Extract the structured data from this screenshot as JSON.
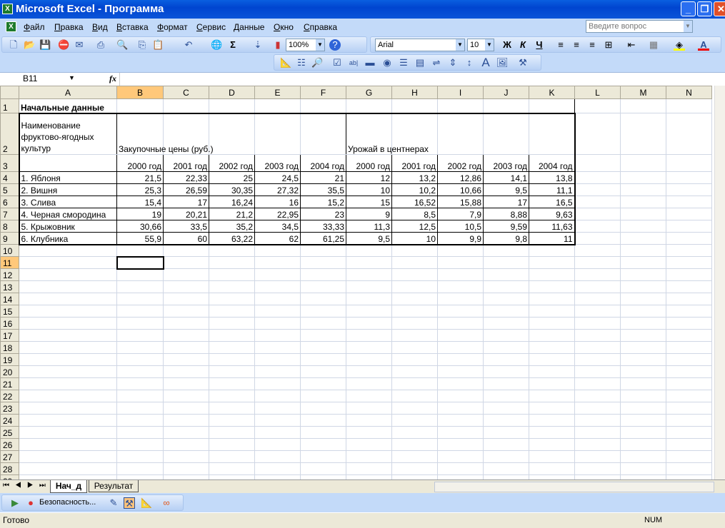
{
  "window": {
    "title": "Microsoft Excel - Программа"
  },
  "menu": [
    "Файл",
    "Правка",
    "Вид",
    "Вставка",
    "Формат",
    "Сервис",
    "Данные",
    "Окно",
    "Справка"
  ],
  "help_search": {
    "placeholder": "Введите вопрос"
  },
  "toolbar": {
    "zoom": "100%",
    "font": "Arial",
    "size": "10",
    "bold": "Ж",
    "italic": "К",
    "underline": "Ч",
    "sum": "Σ"
  },
  "formula_bar": {
    "name_box": "B11",
    "fx": "fx",
    "value": ""
  },
  "sheet": {
    "columns": [
      "A",
      "B",
      "C",
      "D",
      "E",
      "F",
      "G",
      "H",
      "I",
      "J",
      "K",
      "L",
      "M",
      "N"
    ],
    "selected_cell": "B11",
    "rows": [
      [
        "Начальные данные"
      ],
      [
        "Наименование фруктово-ягодных культур",
        "Закупочные цены (руб.)",
        "",
        "",
        "",
        "",
        "Урожай в центнерах"
      ],
      [
        "",
        "2000 год",
        "2001 год",
        "2002 год",
        "2003 год",
        "2004 год",
        "2000 год",
        "2001 год",
        "2002 год",
        "2003 год",
        "2004 год"
      ],
      [
        "1. Яблоня",
        "21,5",
        "22,33",
        "25",
        "24,5",
        "21",
        "12",
        "13,2",
        "12,86",
        "14,1",
        "13,8"
      ],
      [
        "2. Вишня",
        "25,3",
        "26,59",
        "30,35",
        "27,32",
        "35,5",
        "10",
        "10,2",
        "10,66",
        "9,5",
        "11,1"
      ],
      [
        "3. Слива",
        "15,4",
        "17",
        "16,24",
        "16",
        "15,2",
        "15",
        "16,52",
        "15,88",
        "17",
        "16,5"
      ],
      [
        "4. Черная смородина",
        "19",
        "20,21",
        "21,2",
        "22,95",
        "23",
        "9",
        "8,5",
        "7,9",
        "8,88",
        "9,63"
      ],
      [
        "5. Крыжовник",
        "30,66",
        "33,5",
        "35,2",
        "34,5",
        "33,33",
        "11,3",
        "12,5",
        "10,5",
        "9,59",
        "11,63"
      ],
      [
        "6. Клубника",
        "55,9",
        "60",
        "63,22",
        "62",
        "61,25",
        "9,5",
        "10",
        "9,9",
        "9,8",
        "11"
      ]
    ]
  },
  "sheet_tabs": [
    "Нач_д",
    "Результат"
  ],
  "drawing_toolbar": {
    "security": "Безопасность..."
  },
  "status": {
    "left": "Готово",
    "num": "NUM"
  }
}
